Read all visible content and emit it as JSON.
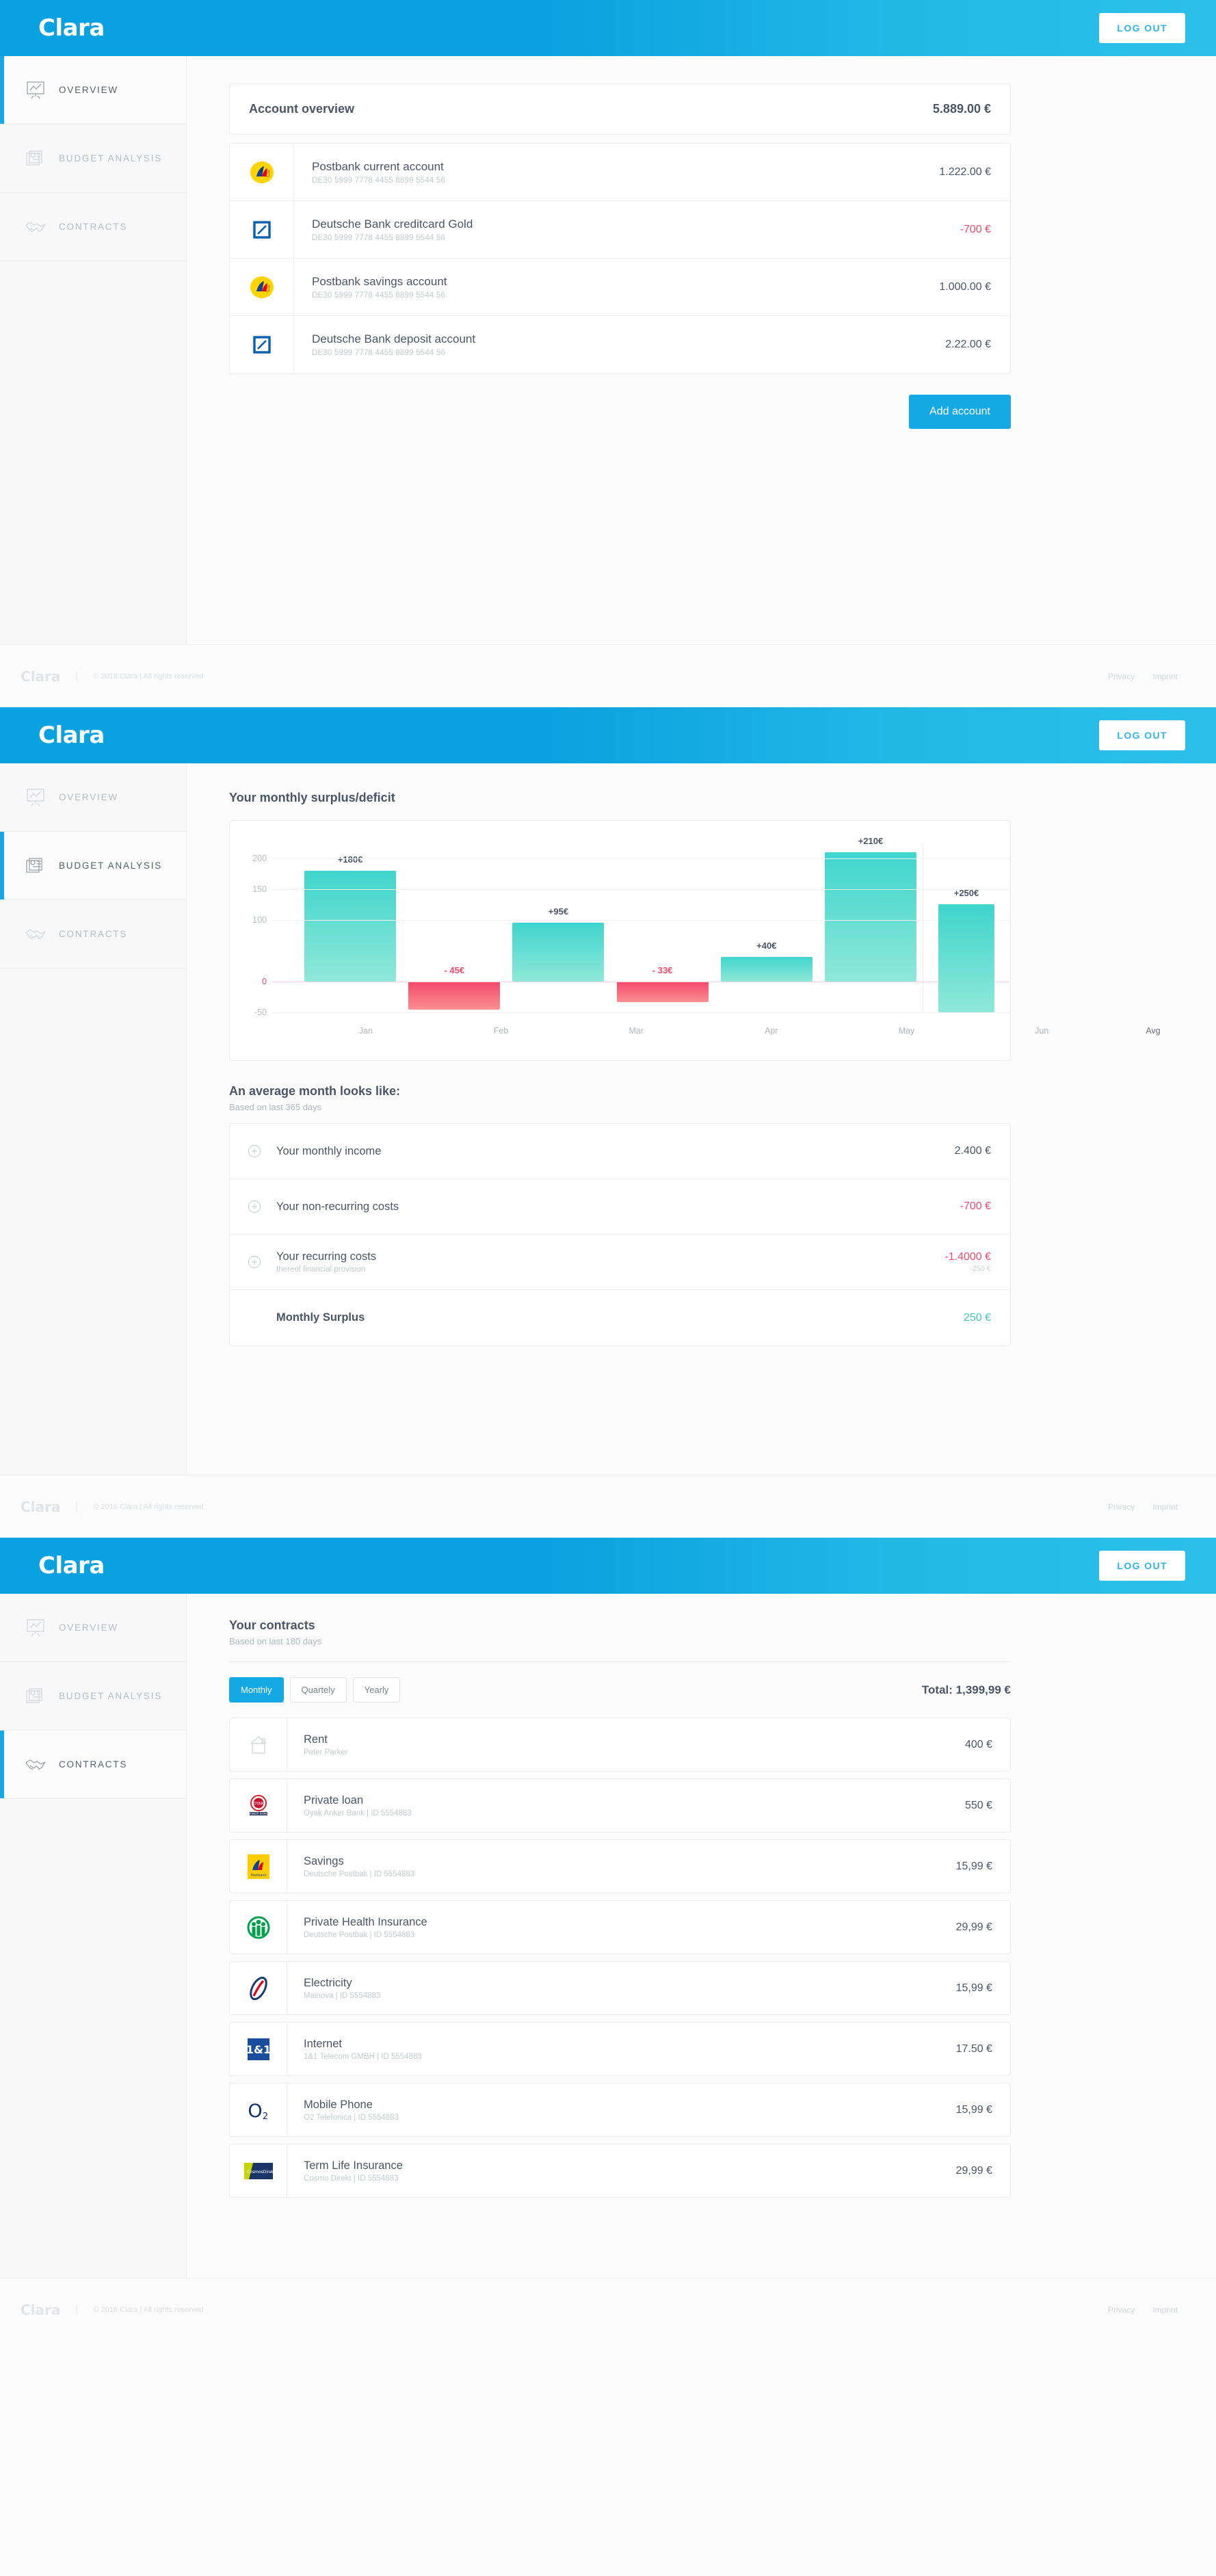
{
  "brand": "Clara",
  "header": {
    "logout_label": "LOG OUT"
  },
  "sidebar": {
    "items": [
      {
        "label": "OVERVIEW",
        "icon": "presentation-chart-icon"
      },
      {
        "label": "BUDGET ANALYSIS",
        "icon": "report-document-icon"
      },
      {
        "label": "CONTRACTS",
        "icon": "handshake-icon"
      }
    ]
  },
  "footer": {
    "brand": "Clara",
    "separator": "|",
    "copyright": "© 2016 Clara | All rights reserved",
    "links": [
      "Privacy",
      "Imprint"
    ]
  },
  "overview": {
    "title": "Account overview",
    "total": "5.889.00 €",
    "accounts": [
      {
        "name": "Postbank current account",
        "iban": "DE30 5999 7778 4455 8899 5544 56",
        "amount": "1.222.00 €",
        "negative": false,
        "logo": "postbank-logo"
      },
      {
        "name": "Deutsche Bank creditcard Gold",
        "iban": "DE30 5999 7778 4455 8899 5544 56",
        "amount": "-700 €",
        "negative": true,
        "logo": "deutsche-bank-logo"
      },
      {
        "name": "Postbank savings account",
        "iban": "DE30 5999 7778 4455 8899 5544 56",
        "amount": "1.000.00 €",
        "negative": false,
        "logo": "postbank-logo"
      },
      {
        "name": "Deutsche Bank deposit account",
        "iban": "DE30 5999 7778 4455 8899 5544 56",
        "amount": "2.22.00 €",
        "negative": false,
        "logo": "deutsche-bank-logo"
      }
    ],
    "add_account_label": "Add account"
  },
  "budget": {
    "chart_title": "Your monthly surplus/deficit",
    "avg_title": "An average month looks like:",
    "avg_subtitle": "Based on last 365 days",
    "rows": [
      {
        "label": "Your monthly income",
        "sub": "",
        "value": "2.400 €",
        "value_sub": "",
        "tone": "neutral",
        "icon": "plus-circle-icon"
      },
      {
        "label": "Your non-recurring costs",
        "sub": "",
        "value": "-700 €",
        "value_sub": "",
        "tone": "neg",
        "icon": "plus-circle-icon"
      },
      {
        "label": "Your recurring costs",
        "sub": "thereof financial provision",
        "value": "-1.4000 €",
        "value_sub": "-250 €",
        "tone": "neg",
        "icon": "plus-circle-icon"
      }
    ],
    "total_label": "Monthly Surplus",
    "total_value": "250 €"
  },
  "chart_data": {
    "type": "bar",
    "title": "Your monthly surplus/deficit",
    "xlabel": "",
    "ylabel": "",
    "ylim": [
      -50,
      225
    ],
    "yticks": [
      200,
      150,
      100,
      0,
      -50
    ],
    "ytick_labels": [
      "200",
      "150",
      "100",
      "0",
      "-50"
    ],
    "grid": true,
    "categories": [
      "Jan",
      "Feb",
      "Mar",
      "Apr",
      "May",
      "Jun",
      "Avg"
    ],
    "values": [
      180,
      -45,
      95,
      -33,
      40,
      210,
      250
    ],
    "data_labels": [
      "+180€",
      "- 45€",
      "+95€",
      "- 33€",
      "+40€",
      "+210€",
      "+250€"
    ],
    "colors": {
      "positive": "#3fd5cd",
      "negative": "#f4496b"
    },
    "separator_before_last": true,
    "legend": "none"
  },
  "contracts": {
    "title": "Your contracts",
    "subtitle": "Based on last 180 days",
    "tabs": [
      {
        "label": "Monthly",
        "active": true
      },
      {
        "label": "Quartely",
        "active": false
      },
      {
        "label": "Yearly",
        "active": false
      }
    ],
    "total": "Total: 1,399,99 €",
    "items": [
      {
        "name": "Rent",
        "meta": "Peter Parker",
        "amount": "400 €",
        "logo": "house-icon"
      },
      {
        "name": "Private loan",
        "meta": "Oyak Anker Bank |  ID 5554883",
        "amount": "550 €",
        "logo": "oyak-anker-bank-logo"
      },
      {
        "name": "Savings",
        "meta": "Deutsche Postbak  |  ID 5554883",
        "amount": "15,99 €",
        "logo": "postbank-square-logo"
      },
      {
        "name": "Private Health Insurance",
        "meta": "Deutsche Postbak  |  ID 5554883",
        "amount": "29,99 €",
        "logo": "health-insurance-logo"
      },
      {
        "name": "Electricity",
        "meta": "Mainova  |  ID 5554883",
        "amount": "15,99 €",
        "logo": "mainova-logo"
      },
      {
        "name": "Internet",
        "meta": "1&1 Telecom GMBH  |  ID 5554883",
        "amount": "17.50 €",
        "logo": "oneandone-logo"
      },
      {
        "name": "Mobile Phone",
        "meta": "O2 Telefonica  |  ID 5554883",
        "amount": "15,99 €",
        "logo": "o2-logo"
      },
      {
        "name": "Term Life Insurance",
        "meta": "Cosmo Direkt  |  ID 5554883",
        "amount": "29,99 €",
        "logo": "cosmos-direkt-logo"
      }
    ]
  },
  "colors": {
    "accent": "#14a9e4",
    "header_left": "#0aa1e0",
    "header_right": "#2cc0e9",
    "positive": "#3fc8bd",
    "negative": "#f4496b",
    "text": "#4a5568"
  }
}
